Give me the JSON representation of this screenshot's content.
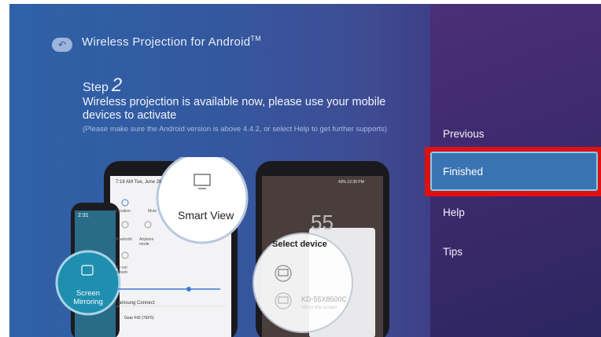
{
  "header": {
    "title_prefix": "Wireless Projection for Android",
    "title_sup": "TM",
    "back_icon": "back-arrow-icon"
  },
  "main": {
    "step_label": "Step",
    "step_number": "2",
    "message": "Wireless projection is available now, please use your mobile devices to activate",
    "note": "(Please make sure the Android version is above 4.4.2, or select Help to get further supports)"
  },
  "illustration": {
    "left_phone": {
      "status": "7:18 AM  Tue, June 26",
      "tiles": [
        "Location",
        "Mute",
        "Bluetooth",
        "Airplane mode",
        "Do not disturb"
      ],
      "smart_view": "Smart View",
      "samsung_connect": "Samsung Connect",
      "device": "Gear Fit2 (7EF5)",
      "screen_mirroring": "Screen Mirroring",
      "small_time": "2:31"
    },
    "right_phone": {
      "status": "43% 12:36 PM",
      "big_number": "55",
      "select_device": "Select device",
      "device_name": "KD-55X8500C",
      "device_sub": "Mirror the screen"
    }
  },
  "menu": {
    "items": [
      "Previous",
      "Finished",
      "Help",
      "Tips"
    ],
    "selected": "Finished"
  },
  "colors": {
    "selection_outline": "#e01010",
    "selection_fill": "#3a73b2",
    "selection_border": "#7fd0ea"
  }
}
